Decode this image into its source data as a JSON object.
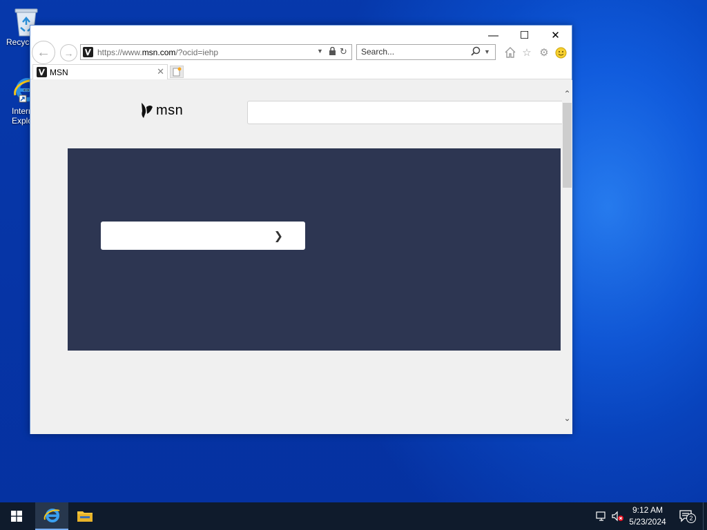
{
  "desktop": {
    "icons": [
      {
        "label": "Recycle Bin",
        "icon": "recycle-bin-icon"
      },
      {
        "label": "Internet Explorer",
        "icon": "internet-explorer-icon"
      }
    ]
  },
  "browser": {
    "address_prefix": "https://www.",
    "address_domain": "msn.com",
    "address_suffix": "/?ocid=iehp",
    "search_placeholder": "Search...",
    "tab_title": "MSN"
  },
  "page": {
    "logo_text": "msn",
    "search_placeholder": "",
    "hero_button_label": ""
  },
  "taskbar": {
    "time": "9:12 AM",
    "date": "5/23/2024",
    "notification_count": "2"
  },
  "colors": {
    "hero_bg": "#2d3652",
    "taskbar_bg": "#0f1b2c",
    "wallpaper_accent": "#1464e6"
  }
}
